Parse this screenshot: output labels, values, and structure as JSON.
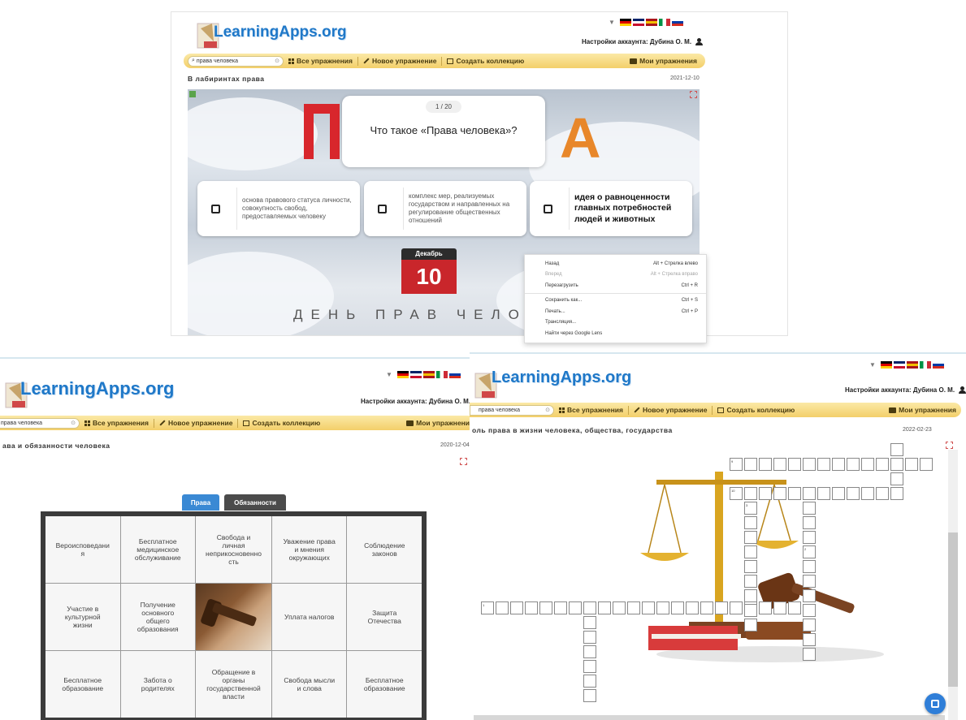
{
  "common": {
    "logo": "LearningApps.org",
    "account_label": "Настройки аккаунта: Дубина О. М.",
    "nav": {
      "search_value": "права человека",
      "all_exercises": "Все упражнения",
      "new_exercise": "Новое упражнение",
      "create_collection": "Создать коллекцию",
      "my_exercises": "Мои упражнения"
    },
    "flag_colors": [
      [
        "#000000",
        "#dd0000",
        "#ffce00"
      ],
      [
        "#012169",
        "#ffffff",
        "#c8102e"
      ],
      [
        "#aa151b",
        "#f1bf00",
        "#aa151b"
      ],
      [
        "#009246",
        "#ffffff",
        "#ce2b37"
      ],
      [
        "#ffffff",
        "#0039a6",
        "#d52b1e"
      ]
    ]
  },
  "top_app": {
    "title": "В лабиринтах права",
    "date": "2021-12-10",
    "question_counter": "1 / 20",
    "question": "Что такое «Права человека»?",
    "answers": [
      {
        "text": "основа правового статуса личности, совокупность свобод, предоставляемых человеку",
        "big": false
      },
      {
        "text": "комплекс мер, реализуемых государством и направленных на регулирование общественных отношений",
        "big": false
      },
      {
        "text": "идея о равноценности главных потребностей людей и животных",
        "big": true
      }
    ],
    "calendar_month": "Декабрь",
    "calendar_day": "10",
    "banner": "ДЕНЬ ПРАВ ЧЕЛО",
    "balloon_letter": "А",
    "context_menu": [
      {
        "label": "Назад",
        "shortcut": "Alt + Стрелка влево",
        "dim": false
      },
      {
        "label": "Вперед",
        "shortcut": "Alt + Стрелка вправо",
        "dim": true
      },
      {
        "label": "Перезагрузить",
        "shortcut": "Ctrl + R",
        "dim": false
      },
      {
        "sep": true
      },
      {
        "label": "Сохранить как...",
        "shortcut": "Ctrl + S",
        "dim": false
      },
      {
        "label": "Печать...",
        "shortcut": "Ctrl + P",
        "dim": false
      },
      {
        "label": "Трансляция...",
        "shortcut": "",
        "dim": false
      },
      {
        "label": "Найти через Google Lens",
        "shortcut": "",
        "dim": false
      }
    ]
  },
  "bottom_left_app": {
    "title": "ава и обязанности человека",
    "date": "2020-12-04",
    "tabs": [
      {
        "label": "Права",
        "active": true
      },
      {
        "label": "Обязанности",
        "active": false
      }
    ],
    "pieces": [
      "Вероисповедани я",
      "Бесплатное медицинское обслуживание",
      "Свобода и личная неприкосновенно сть",
      "Уважение права и мнения окружающих",
      "Соблюдение законов",
      "Участие в культурной жизни",
      "Получение основного общего образования",
      "",
      "Уплата налогов",
      "Защита Отечества",
      "Бесплатное образование",
      "Забота о родителях",
      "Обращение в органы государственной власти",
      "Свобода мысли и слова",
      "Бесплатное образование"
    ]
  },
  "bottom_right_app": {
    "title": "оль права в жизни человека, общества, государства",
    "date": "2022-02-23",
    "crossword_numbers": [
      "9",
      "10",
      "3",
      "1",
      "2",
      "5",
      "4",
      "7",
      "6",
      "8"
    ]
  }
}
